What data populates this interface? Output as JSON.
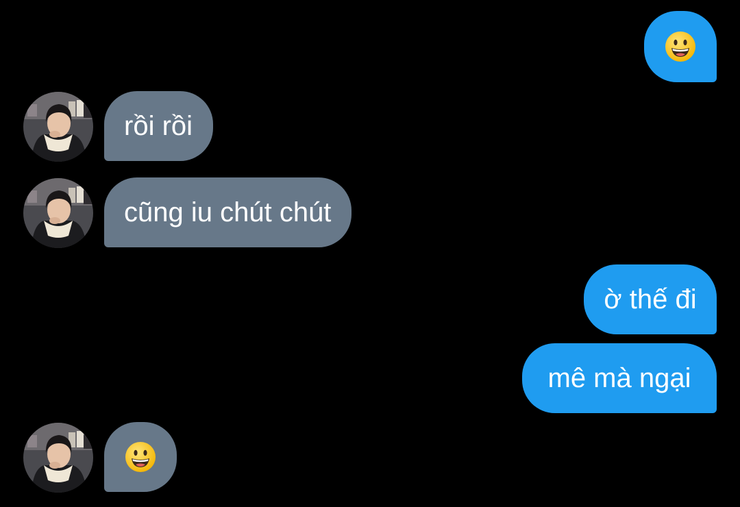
{
  "conversation": {
    "messages": [
      {
        "sender": "me",
        "kind": "emoji",
        "emoji": "grinning-face-emoji"
      },
      {
        "sender": "contact",
        "kind": "text",
        "text": "rồi rồi"
      },
      {
        "sender": "contact",
        "kind": "text",
        "text": "cũng iu chút chút"
      },
      {
        "sender": "me",
        "kind": "text",
        "text": "ờ thế đi"
      },
      {
        "sender": "me",
        "kind": "text",
        "text": "mê mà ngại"
      },
      {
        "sender": "contact",
        "kind": "emoji",
        "emoji": "grinning-face-emoji"
      }
    ]
  },
  "colors": {
    "background": "#000000",
    "sent_bubble": "#1f9cf0",
    "received_bubble": "#677889",
    "text": "#ffffff"
  }
}
